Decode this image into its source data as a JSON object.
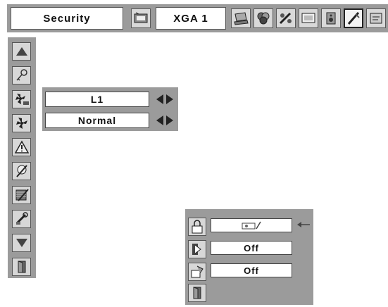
{
  "topbar": {
    "title": "Security",
    "input_source": "XGA 1",
    "icons": [
      "projector-image-icon",
      "computer-input-icon",
      "color-adjust-icon",
      "image-adjust-icon",
      "screen-icon",
      "sound-icon",
      "setting-icon",
      "info-icon"
    ],
    "selected_icon": "setting-icon"
  },
  "sidebar": {
    "icons": [
      "scroll-up-icon",
      "key-icon",
      "fan-off-icon",
      "fan-icon",
      "warning-icon",
      "lamp-icon",
      "filter-icon",
      "tools-icon",
      "scroll-down-icon",
      "exit-icon"
    ]
  },
  "fan_submenu": {
    "row1_value": "L1",
    "row2_value": "Normal"
  },
  "security_submenu": {
    "rows": [
      {
        "icon": "lock-icon",
        "value": "projector-lock-icon"
      },
      {
        "icon": "pin-lock-icon",
        "value": "Off"
      },
      {
        "icon": "logo-lock-icon",
        "value": "Off"
      },
      {
        "icon": "exit-icon",
        "value": ""
      }
    ]
  }
}
